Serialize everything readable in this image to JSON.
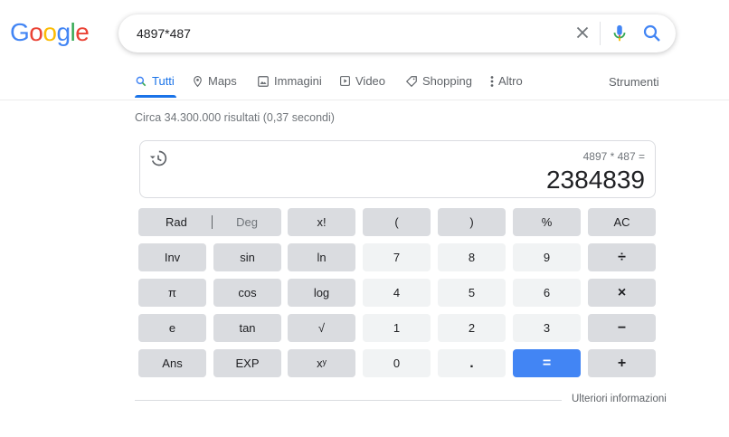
{
  "logo": [
    "G",
    "o",
    "o",
    "g",
    "l",
    "e"
  ],
  "logo_colors": [
    "#4285f4",
    "#ea4335",
    "#fbbc05",
    "#4285f4",
    "#34a853",
    "#ea4335"
  ],
  "search": {
    "query": "4897*487"
  },
  "tabs": [
    {
      "label": "Tutti",
      "icon": "search-icon",
      "active": true
    },
    {
      "label": "Maps",
      "icon": "map-pin-icon"
    },
    {
      "label": "Immagini",
      "icon": "image-icon"
    },
    {
      "label": "Video",
      "icon": "video-icon"
    },
    {
      "label": "Shopping",
      "icon": "tag-icon"
    },
    {
      "label": "Altro",
      "icon": "more-vert-icon"
    }
  ],
  "tools_label": "Strumenti",
  "result_stats": "Circa 34.300.000 risultati (0,37 secondi)",
  "calculator": {
    "expression": "4897 * 487 =",
    "result": "2384839",
    "rad": "Rad",
    "deg": "Deg",
    "keys": [
      [
        "x!",
        "(",
        ")",
        "%",
        "AC"
      ],
      [
        "Inv",
        "sin",
        "ln",
        "7",
        "8",
        "9",
        "÷"
      ],
      [
        "π",
        "cos",
        "log",
        "4",
        "5",
        "6",
        "×"
      ],
      [
        "e",
        "tan",
        "√",
        "1",
        "2",
        "3",
        "−"
      ],
      [
        "Ans",
        "EXP",
        "xʸ",
        "0",
        ".",
        "=",
        "+"
      ]
    ]
  },
  "more_info": "Ulteriori informazioni",
  "colors": {
    "accent": "#1a73e8",
    "equals": "#4285f4",
    "fn_key": "#dadce0",
    "num_key": "#f1f3f4"
  }
}
